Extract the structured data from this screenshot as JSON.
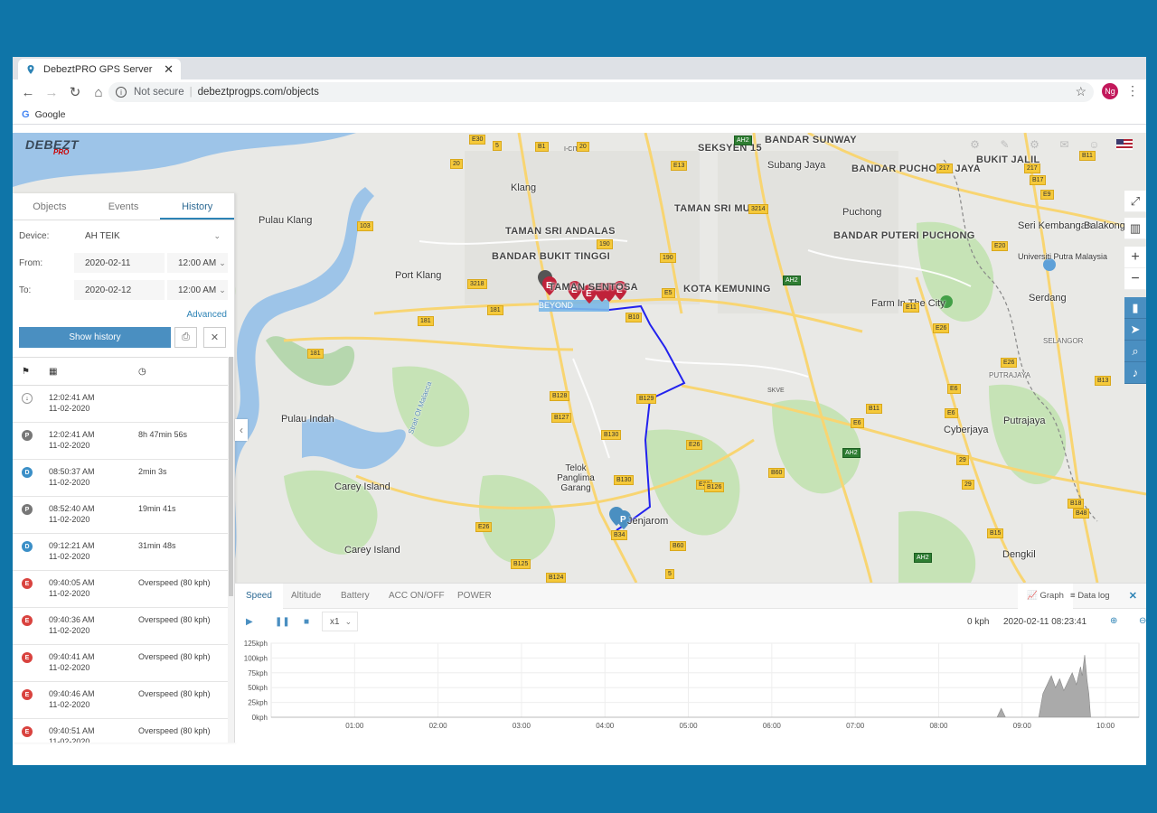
{
  "browser": {
    "tab_title": "DebeztPRO GPS Server",
    "secure_text": "Not secure",
    "url": "debeztprogps.com/objects",
    "bookmark": "Google",
    "avatar_initials": "Ng"
  },
  "app": {
    "logo_main": "DEBEZT",
    "logo_sub": "PRO"
  },
  "panel": {
    "tabs": [
      "Objects",
      "Events",
      "History"
    ],
    "device_label": "Device:",
    "device_value": "AH TEIK",
    "from_label": "From:",
    "from_date": "2020-02-11",
    "from_time": "12:00 AM",
    "to_label": "To:",
    "to_date": "2020-02-12",
    "to_time": "12:00 AM",
    "advanced": "Advanced",
    "show_history": "Show history"
  },
  "events": [
    {
      "badge": "arrow",
      "color": "#ffffff",
      "time": "12:02:41 AM",
      "date": "11-02-2020",
      "info": ""
    },
    {
      "badge": "P",
      "color": "#777777",
      "time": "12:02:41 AM",
      "date": "11-02-2020",
      "info": "8h 47min 56s"
    },
    {
      "badge": "D",
      "color": "#3b8fc7",
      "time": "08:50:37 AM",
      "date": "11-02-2020",
      "info": "2min 3s"
    },
    {
      "badge": "P",
      "color": "#777777",
      "time": "08:52:40 AM",
      "date": "11-02-2020",
      "info": "19min 41s"
    },
    {
      "badge": "D",
      "color": "#3b8fc7",
      "time": "09:12:21 AM",
      "date": "11-02-2020",
      "info": "31min 48s"
    },
    {
      "badge": "E",
      "color": "#d9433f",
      "time": "09:40:05 AM",
      "date": "11-02-2020",
      "info": "Overspeed (80 kph)"
    },
    {
      "badge": "E",
      "color": "#d9433f",
      "time": "09:40:36 AM",
      "date": "11-02-2020",
      "info": "Overspeed (80 kph)"
    },
    {
      "badge": "E",
      "color": "#d9433f",
      "time": "09:40:41 AM",
      "date": "11-02-2020",
      "info": "Overspeed (80 kph)"
    },
    {
      "badge": "E",
      "color": "#d9433f",
      "time": "09:40:46 AM",
      "date": "11-02-2020",
      "info": "Overspeed (80 kph)"
    },
    {
      "badge": "E",
      "color": "#d9433f",
      "time": "09:40:51 AM",
      "date": "11-02-2020",
      "info": "Overspeed (80 kph)"
    }
  ],
  "map_labels": {
    "places": [
      "SEKSYEN 15",
      "BANDAR SUNWAY",
      "Subang Jaya",
      "BANDAR PUCHONG JAYA",
      "BUKIT JALIL",
      "Klang",
      "Pulau Klang",
      "TAMAN SRI ANDALAS",
      "BANDAR BUKIT TINGGI",
      "TAMAN SRI MUDA",
      "Puchong",
      "BANDAR PUTERI PUCHONG",
      "Seri Kembangan",
      "Balakong",
      "Port Klang",
      "TAMAN SENTOSA",
      "KOTA KEMUNING",
      "Farm In The City",
      "Serdang",
      "Universiti Putra Malaysia",
      "Telok Panglima Garang",
      "Pulau Indah",
      "Carey Island",
      "Carey Island",
      "Cyberjaya",
      "Putrajaya",
      "Dengkil",
      "BEYOND",
      "Jenjarom",
      "Strait Of Malacca",
      "SELANGOR",
      "PUTRAJAYA"
    ],
    "roads": [
      "E30",
      "5",
      "B1",
      "20",
      "I-CITY",
      "AH2",
      "E13",
      "20",
      "3214",
      "103",
      "190",
      "190",
      "181",
      "3218",
      "E5",
      "AH2",
      "B10",
      "181",
      "181",
      "B128",
      "B127",
      "B130",
      "B129",
      "E26",
      "B60",
      "E26",
      "B130",
      "B126",
      "E26",
      "B34",
      "B60",
      "B125",
      "B124",
      "5",
      "SKVE",
      "E6",
      "AH2",
      "B11",
      "E26",
      "E6",
      "E11",
      "29",
      "B13",
      "E6",
      "29",
      "B18",
      "B48",
      "B15",
      "AH2",
      "E26",
      "E20",
      "B11",
      "217",
      "217",
      "E9",
      "B17"
    ]
  },
  "bottom": {
    "tabs": [
      "Speed",
      "Altitude",
      "Battery",
      "ACC ON/OFF",
      "POWER"
    ],
    "graph_label": "Graph",
    "datalog_label": "Data log",
    "speed_mult": "x1",
    "current_speed": "0 kph",
    "current_time": "2020-02-11 08:23:41"
  },
  "chart_data": {
    "type": "area",
    "title": "",
    "xlabel": "",
    "ylabel": "",
    "ylim": [
      0,
      125
    ],
    "yticks": [
      "125kph",
      "100kph",
      "75kph",
      "50kph",
      "25kph",
      "0kph"
    ],
    "xticks": [
      "01:00",
      "02:00",
      "03:00",
      "04:00",
      "05:00",
      "06:00",
      "07:00",
      "08:00",
      "09:00",
      "10:00"
    ],
    "x_unit": "hours",
    "xlim": [
      0.0,
      10.4
    ],
    "series": [
      {
        "values_x": [
          0,
          8.7,
          8.75,
          8.8,
          8.85,
          9.0,
          9.2,
          9.25,
          9.3,
          9.35,
          9.4,
          9.45,
          9.5,
          9.55,
          9.6,
          9.65,
          9.7,
          9.72,
          9.75,
          9.78,
          9.8,
          9.82,
          10.4
        ],
        "values_y": [
          0,
          0,
          15,
          0,
          0,
          0,
          0,
          40,
          55,
          70,
          50,
          65,
          45,
          60,
          75,
          55,
          85,
          70,
          105,
          60,
          40,
          0,
          0
        ]
      }
    ]
  }
}
